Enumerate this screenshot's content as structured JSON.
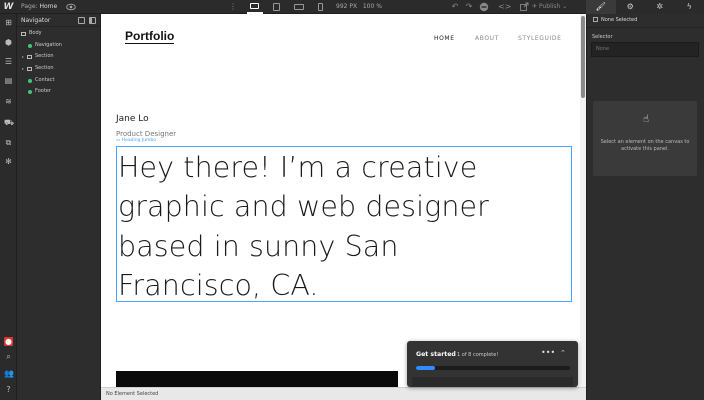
{
  "topbar": {
    "logo": "W",
    "page_prefix": "Page:",
    "page_name": "Home",
    "canvas_width": "992 PX",
    "zoom": "100 %",
    "publish": "Publish"
  },
  "navigator": {
    "title": "Navigator",
    "items": [
      {
        "label": "Body",
        "type": "box",
        "depth": 0,
        "expandable": false
      },
      {
        "label": "Navigation",
        "type": "symbol",
        "depth": 1,
        "expandable": false
      },
      {
        "label": "Section",
        "type": "box",
        "depth": 1,
        "expandable": true
      },
      {
        "label": "Section",
        "type": "box",
        "depth": 1,
        "expandable": true
      },
      {
        "label": "Contact",
        "type": "symbol",
        "depth": 1,
        "expandable": false
      },
      {
        "label": "Footer",
        "type": "symbol",
        "depth": 1,
        "expandable": false
      }
    ]
  },
  "site": {
    "brand": "Portfolio",
    "nav_links": [
      "HOME",
      "ABOUT",
      "STYLEGUIDE"
    ],
    "name": "Jane Lo",
    "role": "Product Designer",
    "element_tag": "Heading Jumbo",
    "heading_lines": [
      "Hey there! I’m a creative",
      "graphic and web designer",
      "based in sunny San",
      "Francisco, CA."
    ]
  },
  "statusbar": {
    "text": "No Element Selected"
  },
  "get_started": {
    "title": "Get started",
    "progress_text": "1 of 8 complete!",
    "completed": 1,
    "total": 8,
    "accent": "#2d8cff"
  },
  "right_panel": {
    "selection": "None Selected",
    "selector_label": "Selector",
    "selector_placeholder": "None",
    "hint": "Select an element on the canvas to activate this panel."
  },
  "colors": {
    "chrome": "#2b2b2b",
    "selection_outline": "#4aa3ff",
    "symbol_green": "#46c37b"
  }
}
